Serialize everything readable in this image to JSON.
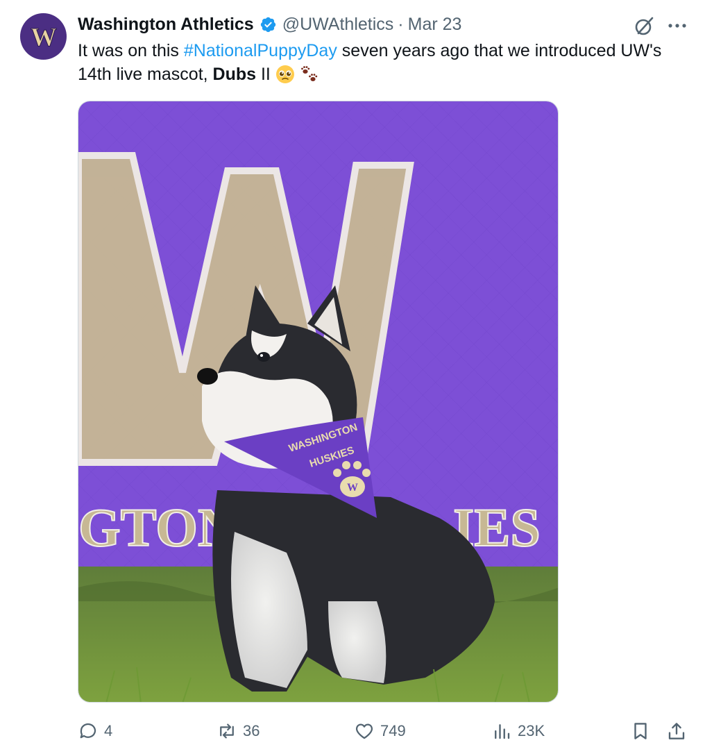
{
  "account": {
    "name": "Washington Athletics",
    "handle": "@UWAthletics",
    "separator": "·",
    "date": "Mar 23",
    "avatar_letter": "W"
  },
  "tweet": {
    "text_before": "It was on this ",
    "hashtag": "#NationalPuppyDay",
    "text_middle": " seven years ago that we introduced UW's 14th live mascot, ",
    "bold_name": "Dubs",
    "text_after": " II "
  },
  "media": {
    "banner_partial_text": "GTON",
    "banner_partial_text_right": "IES",
    "bandana_line1": "WASHINGTON",
    "bandana_line2": "HUSKIES",
    "paw_letter": "W"
  },
  "actions": {
    "replies": "4",
    "reposts": "36",
    "likes": "749",
    "views": "23K"
  },
  "icons": {
    "verified": "verified-badge-icon",
    "grok": "grok-icon",
    "more": "more-dots-icon",
    "reply": "reply-icon",
    "repost": "repost-icon",
    "like": "heart-icon",
    "views": "views-icon",
    "bookmark": "bookmark-icon",
    "share": "share-icon"
  },
  "colors": {
    "accent": "#1d9bf0",
    "uw_purple": "#4b2e83",
    "uw_gold": "#b7a57a",
    "muted": "#536471"
  }
}
